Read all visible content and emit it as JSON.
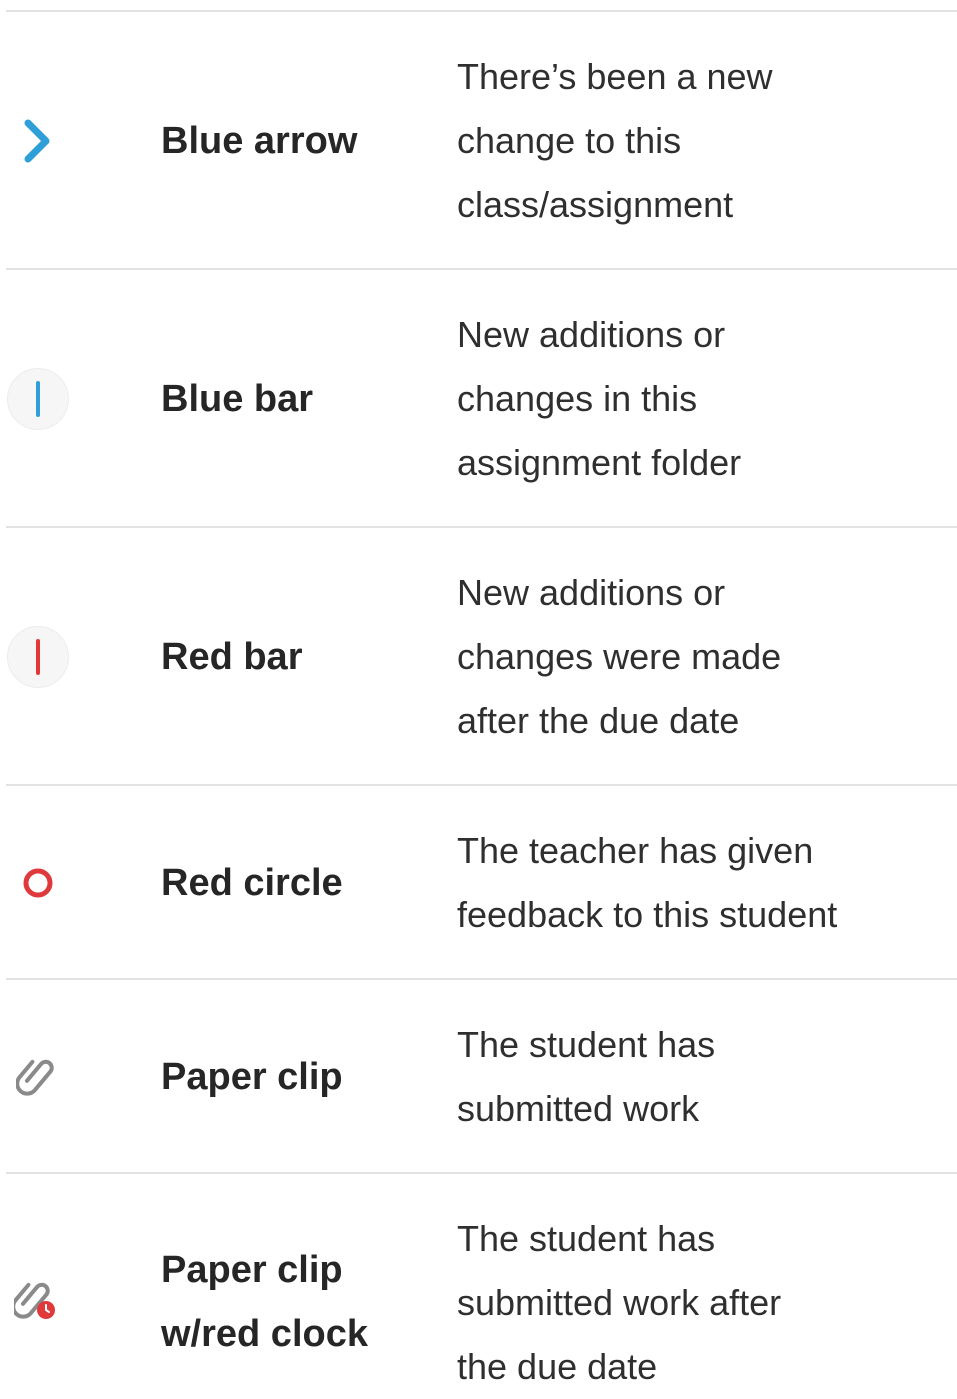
{
  "colors": {
    "blue": "#2f9fd8",
    "red": "#e0393c",
    "gray_icon": "#8a8a8a",
    "divider": "#e3e3e3"
  },
  "legend": [
    {
      "icon": "chevron-right-icon",
      "name": "Blue arrow",
      "description": "There’s been a new\nchange to this\nclass/assignment"
    },
    {
      "icon": "blue-bar-icon",
      "name": "Blue bar",
      "description": "New additions or\nchanges in this\nassignment folder"
    },
    {
      "icon": "red-bar-icon",
      "name": "Red bar",
      "description": "New additions or\nchanges were made\nafter the due date"
    },
    {
      "icon": "red-circle-icon",
      "name": "Red circle",
      "description": "The teacher has given\nfeedback to this student"
    },
    {
      "icon": "paperclip-icon",
      "name": "Paper clip",
      "description": "The student has\nsubmitted work"
    },
    {
      "icon": "paperclip-red-clock-icon",
      "name": "Paper clip\nw/red clock",
      "description": "The student has\nsubmitted work after\nthe due date"
    }
  ]
}
